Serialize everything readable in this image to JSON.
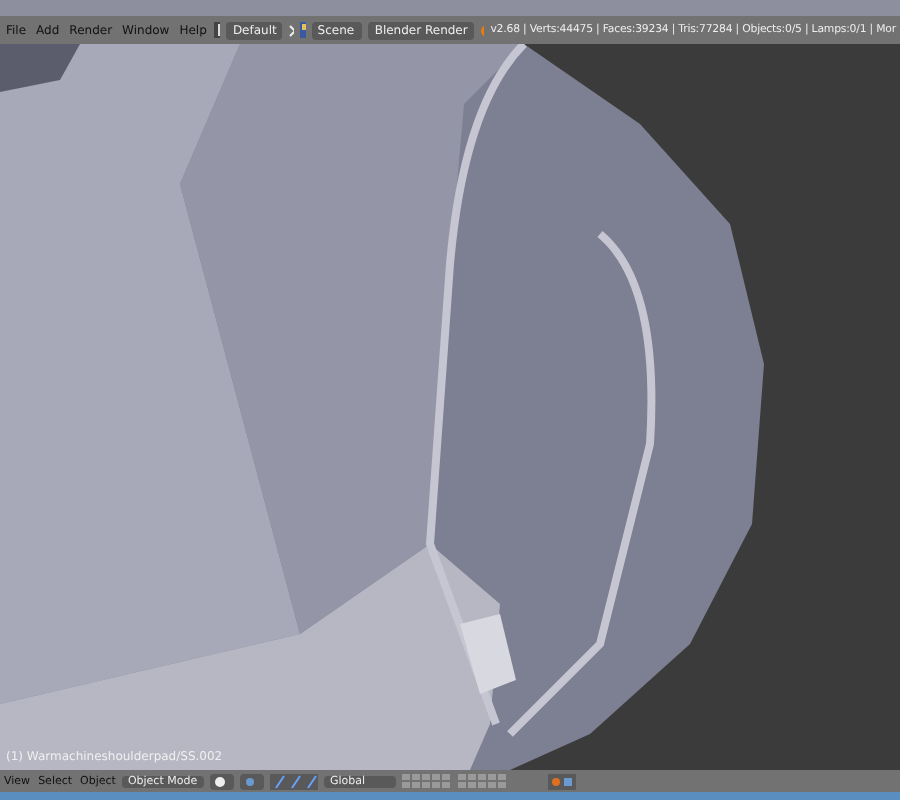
{
  "menu": [
    "File",
    "Add",
    "Render",
    "Window",
    "Help"
  ],
  "screen_layout": "Default",
  "scene": "Scene",
  "render_engine": "Blender Render",
  "stats": "v2.68 | Verts:44475 | Faces:39234 | Tris:77284 | Objects:0/5 | Lamps:0/1 | Mor",
  "viewport": {
    "object_label": "(1) Warmachineshoulderpad/SS.002"
  },
  "footer": {
    "menu": [
      "View",
      "Select",
      "Object"
    ],
    "mode": "Object Mode",
    "orientation": "Global"
  }
}
